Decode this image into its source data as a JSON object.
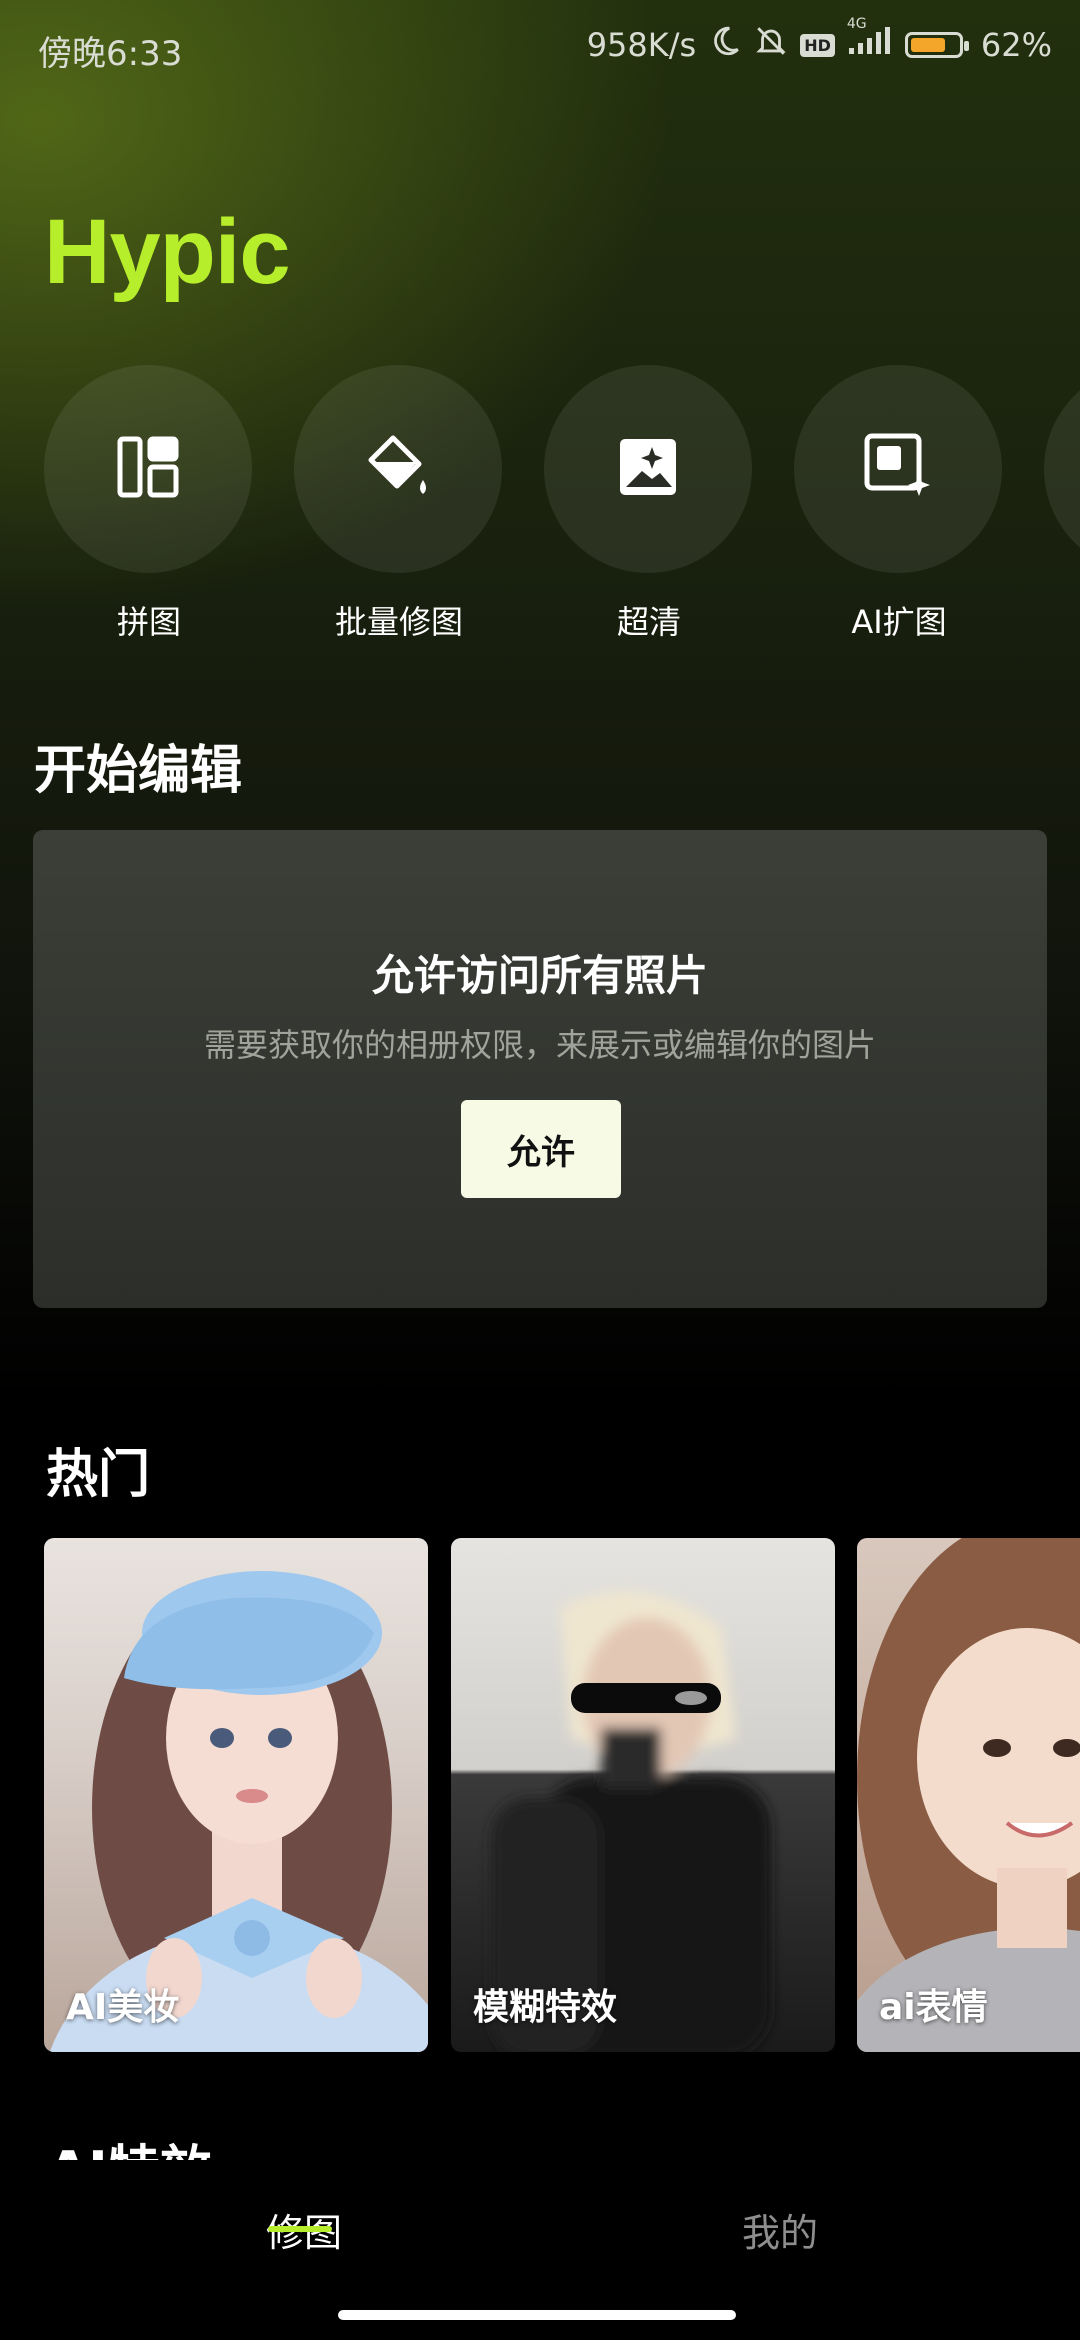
{
  "status": {
    "time": "傍晚6:33",
    "net_speed": "958K/s",
    "hd_badge": "HD",
    "network": "4G",
    "battery": "62%",
    "battery_level": 0.62,
    "battery_color": "#f4a62a"
  },
  "app": {
    "logo": "Hypic",
    "accent": "#b7ee2c"
  },
  "quick_tools": [
    {
      "label": "拼图",
      "icon": "collage-icon"
    },
    {
      "label": "批量修图",
      "icon": "paint-bucket-icon"
    },
    {
      "label": "超清",
      "icon": "sparkle-image-icon"
    },
    {
      "label": "AI扩图",
      "icon": "expand-sparkle-icon"
    }
  ],
  "edit_section": {
    "title": "开始编辑",
    "permission_title": "允许访问所有照片",
    "permission_desc": "需要获取你的相册权限，来展示或编辑你的图片",
    "allow_button": "允许"
  },
  "hot_section": {
    "title": "热门",
    "cards": [
      {
        "label": "AI美妆"
      },
      {
        "label": "模糊特效"
      },
      {
        "label": "ai表情"
      }
    ]
  },
  "ai_section": {
    "title": "AI特效"
  },
  "tabs": [
    {
      "label": "修图",
      "active": true
    },
    {
      "label": "我的",
      "active": false
    }
  ]
}
